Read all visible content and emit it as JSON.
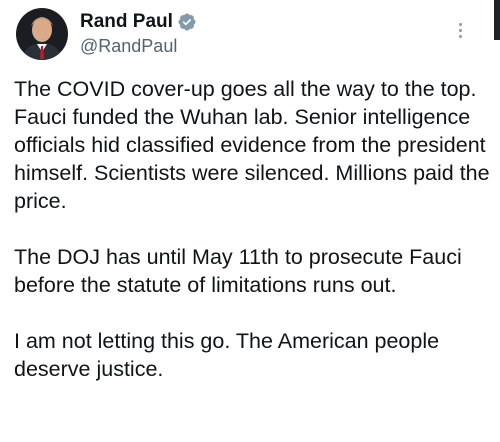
{
  "author": {
    "display_name": "Rand Paul",
    "handle": "@RandPaul",
    "verified_icon": "verified-badge-icon",
    "avatar_icon": "avatar"
  },
  "menu": {
    "icon": "more-options-icon"
  },
  "tweet": {
    "paragraphs": [
      "The COVID cover-up goes all the way to the top. Fauci funded the Wuhan lab. Senior intelligence officials hid classified evidence from the president himself. Scientists were silenced. Millions paid the price.",
      "The DOJ has until May 11th to prosecute Fauci before the statute of limitations runs out.",
      "I am not letting this go. The American people deserve justice."
    ]
  },
  "colors": {
    "text": "#0f1419",
    "secondary_text": "#536471",
    "verified_badge": "#829aab",
    "menu_dots": "#8b98a5"
  }
}
